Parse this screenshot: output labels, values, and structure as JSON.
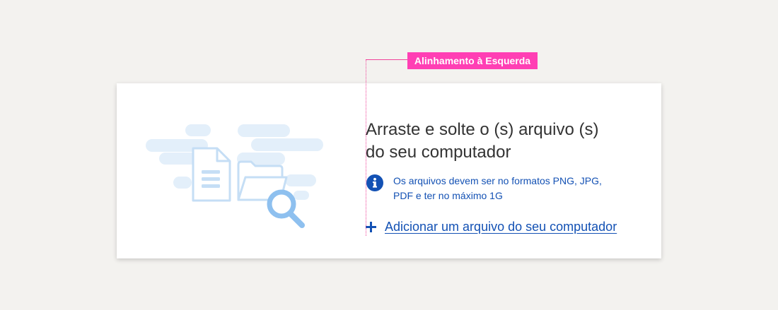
{
  "annotation": {
    "label": "Alinhamento à Esquerda",
    "color": "#ff3fb4"
  },
  "upload": {
    "title_line1": "Arraste e solte o (s) arquivo (s)",
    "title_line2": "do seu computador",
    "info_line1": "Os arquivos devem ser no formatos PNG, JPG,",
    "info_line2": "PDF e ter no máximo 1G",
    "add_label": "Adicionar um arquivo do seu computador"
  },
  "icons": {
    "illustration": "file-folder-search-illustration",
    "info": "info-icon",
    "add": "plus-icon"
  },
  "colors": {
    "background": "#f3f2ef",
    "card": "#ffffff",
    "primary": "#1351b4",
    "text": "#333333",
    "cloud": "#e3effa",
    "illustration_stroke": "#c5def5",
    "magnifier": "#8ec0ef"
  }
}
